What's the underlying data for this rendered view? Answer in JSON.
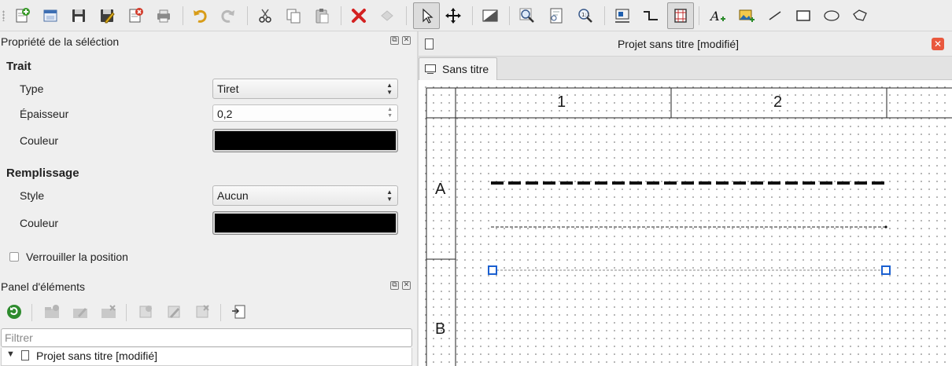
{
  "toolbar": {
    "buttons": [
      "new-project",
      "open-project",
      "save",
      "save-as",
      "close-project",
      "print",
      "undo",
      "redo",
      "cut",
      "copy",
      "paste",
      "delete",
      "rotate",
      "select",
      "move",
      "background",
      "zoom-fit",
      "page-fit",
      "zoom-reset",
      "conductor-auto",
      "conductor",
      "grid-toggle",
      "add-text",
      "add-image",
      "add-line",
      "add-rectangle",
      "add-ellipse",
      "add-polygon"
    ]
  },
  "properties_panel": {
    "title": "Propriété de la séléction",
    "stroke_section": "Trait",
    "type_label": "Type",
    "type_value": "Tiret",
    "thickness_label": "Épaisseur",
    "thickness_value": "0,2",
    "color_label": "Couleur",
    "stroke_color": "#000000",
    "fill_section": "Remplissage",
    "style_label": "Style",
    "style_value": "Aucun",
    "fill_color_label": "Couleur",
    "fill_color": "#000000",
    "lock_label": "Verrouiller la position",
    "lock_checked": false
  },
  "elements_panel": {
    "title": "Panel d'éléments",
    "filter_placeholder": "Filtrer",
    "tree_item": "Projet sans titre [modifié]"
  },
  "document": {
    "title": "Projet sans titre [modifié]",
    "tab_label": "Sans titre",
    "columns": [
      "1",
      "2"
    ],
    "rows": [
      "A",
      "B"
    ]
  }
}
